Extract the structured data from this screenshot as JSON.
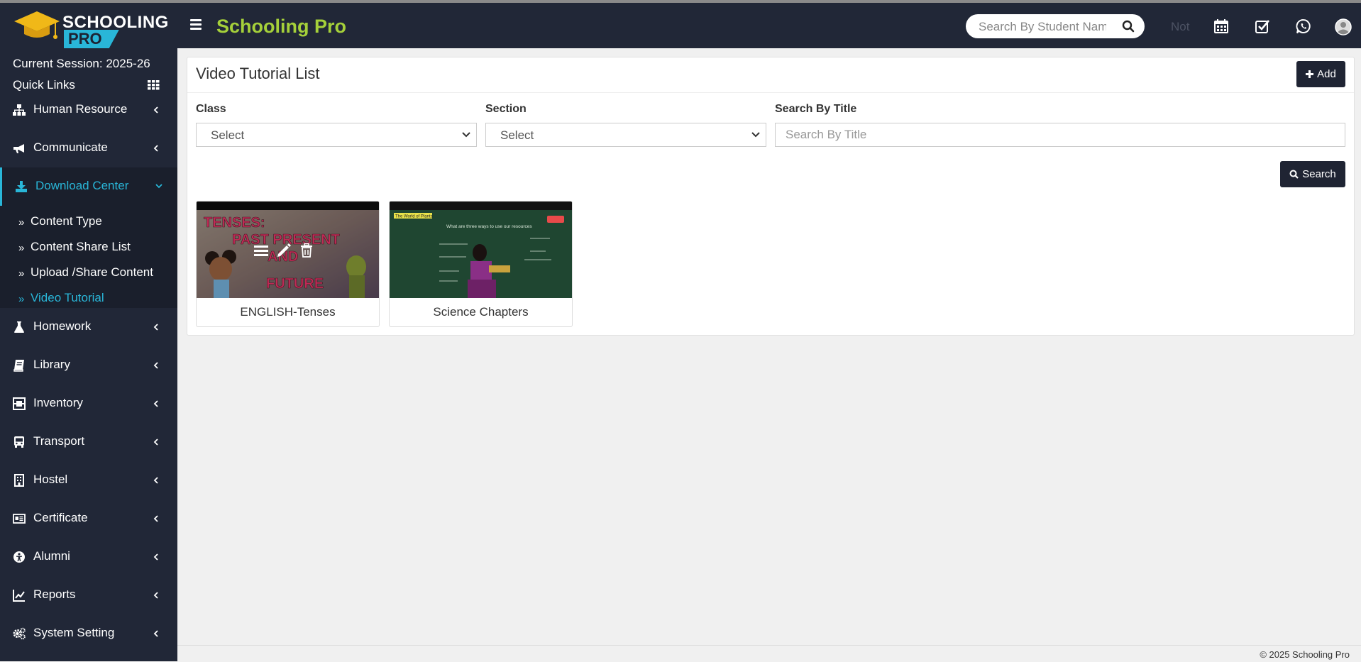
{
  "header": {
    "logo_top": "SCHOOLING",
    "logo_bottom": "PRO",
    "brand": "Schooling Pro",
    "search_placeholder": "Search By Student Nam",
    "notification_text": "Not",
    "icons": [
      "calendar-icon",
      "task-check-icon",
      "whatsapp-icon",
      "user-avatar-icon"
    ],
    "colors": {
      "bar": "#212737",
      "brand": "#a5d03a",
      "accent": "#29b6d8"
    }
  },
  "sidebar": {
    "session": "Current Session: 2025-26",
    "quick_links": "Quick Links",
    "items": [
      {
        "label": "Human Resource",
        "icon": "sitemap-icon"
      },
      {
        "label": "Communicate",
        "icon": "bullhorn-icon"
      },
      {
        "label": "Download Center",
        "icon": "download-icon",
        "active": true
      },
      {
        "label": "Homework",
        "icon": "flask-icon"
      },
      {
        "label": "Library",
        "icon": "book-icon"
      },
      {
        "label": "Inventory",
        "icon": "inventory-icon"
      },
      {
        "label": "Transport",
        "icon": "bus-icon"
      },
      {
        "label": "Hostel",
        "icon": "building-icon"
      },
      {
        "label": "Certificate",
        "icon": "certificate-icon"
      },
      {
        "label": "Alumni",
        "icon": "alumni-icon"
      },
      {
        "label": "Reports",
        "icon": "line-chart-icon"
      },
      {
        "label": "System Setting",
        "icon": "gears-icon"
      }
    ],
    "submenu": [
      {
        "label": "Content Type"
      },
      {
        "label": "Content Share List"
      },
      {
        "label": "Upload /Share Content"
      },
      {
        "label": "Video Tutorial",
        "current": true
      }
    ]
  },
  "main": {
    "title": "Video Tutorial List",
    "add_label": "Add",
    "filters": {
      "class_label": "Class",
      "class_value": "Select",
      "section_label": "Section",
      "section_value": "Select",
      "title_label": "Search By Title",
      "title_placeholder": "Search By Title"
    },
    "search_label": "Search",
    "videos": [
      {
        "title": "ENGLISH-Tenses",
        "thumb_text": [
          "TENSES:",
          "PAST PRESENT",
          "AND",
          "FUTURE"
        ]
      },
      {
        "title": "Science Chapters",
        "thumb_text": [
          "The World of Plants",
          "What are three ways to use our resources"
        ]
      }
    ]
  },
  "footer": {
    "copyright": "© 2025 Schooling Pro"
  }
}
